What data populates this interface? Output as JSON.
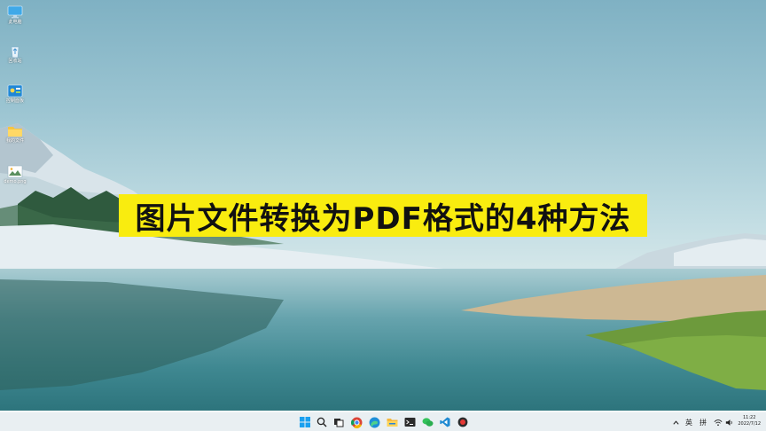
{
  "banner": {
    "title": "图片文件转换为PDF格式的4种方法"
  },
  "desktop": {
    "icons": [
      {
        "label": "此电脑",
        "icon": "computer-icon"
      },
      {
        "label": "回收站",
        "icon": "recycle-bin-icon"
      },
      {
        "label": "控制面板",
        "icon": "control-panel-icon"
      },
      {
        "label": "我的文件",
        "icon": "folder-icon"
      },
      {
        "label": "demo.png",
        "icon": "image-file-icon"
      }
    ]
  },
  "taskbar": {
    "apps": [
      "windows-start-icon",
      "search-icon",
      "task-view-icon",
      "chrome-icon",
      "edge-icon",
      "file-explorer-icon",
      "terminal-icon",
      "wechat-icon",
      "vscode-icon",
      "recorder-icon"
    ],
    "tray": {
      "ime_language": "英",
      "ime_mode": "拼"
    },
    "clock": {
      "time": "11:22",
      "date": "2022/7/12"
    }
  },
  "colors": {
    "banner_bg": "#f9ec0f",
    "banner_text": "#111111",
    "taskbar_bg": "#e8eef1",
    "accent": "#0078d4"
  }
}
